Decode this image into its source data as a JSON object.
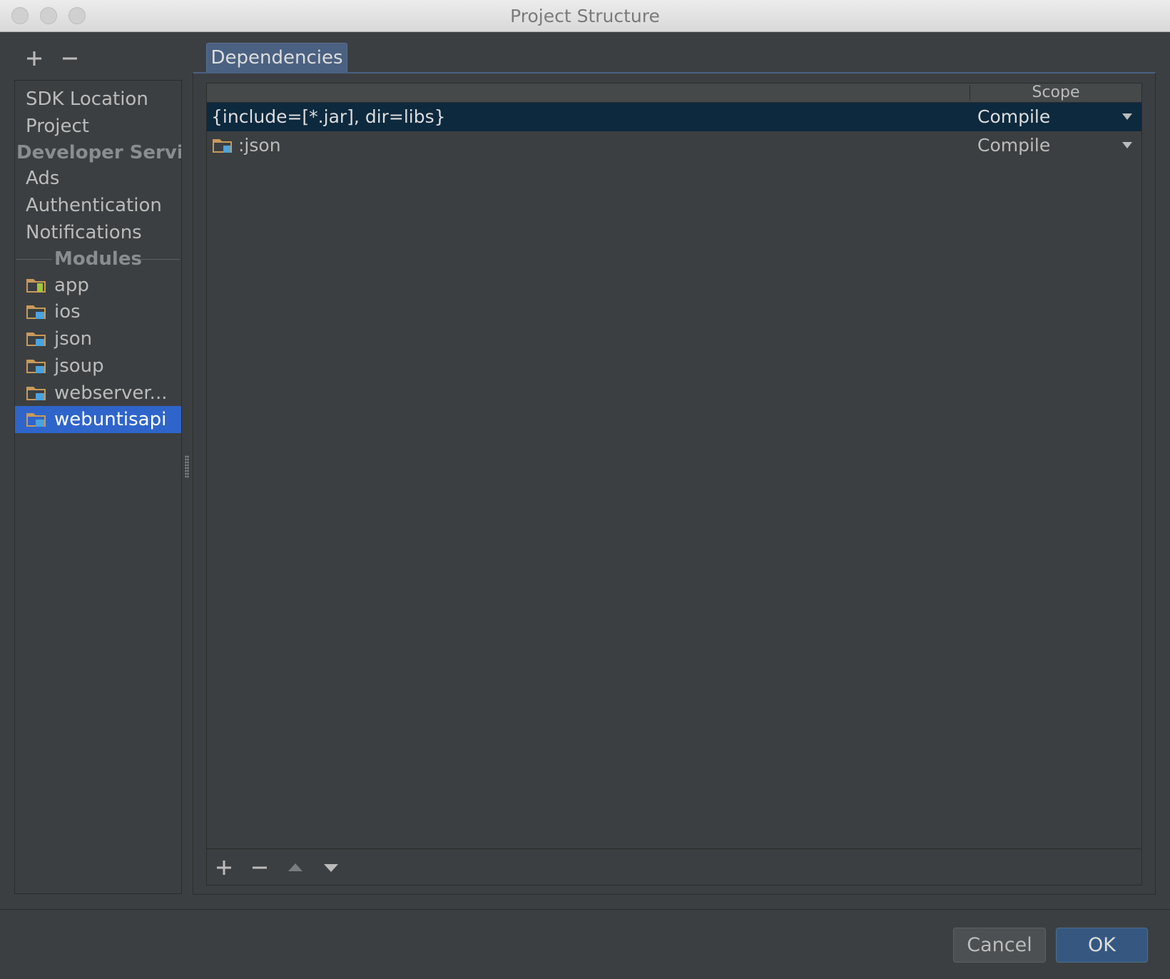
{
  "window": {
    "title": "Project Structure"
  },
  "sidebar": {
    "items": [
      {
        "label": "SDK Location"
      },
      {
        "label": "Project"
      }
    ],
    "developer_services": {
      "header": "Developer Servi...",
      "items": [
        {
          "label": "Ads"
        },
        {
          "label": "Authentication"
        },
        {
          "label": "Notifications"
        }
      ]
    },
    "modules_header": "Modules",
    "modules": [
      {
        "label": "app",
        "icon": "android-module-folder-icon"
      },
      {
        "label": "ios",
        "icon": "java-module-folder-icon"
      },
      {
        "label": "json",
        "icon": "java-module-folder-icon"
      },
      {
        "label": "jsoup",
        "icon": "java-module-folder-icon"
      },
      {
        "label": "webserver...",
        "icon": "java-module-folder-icon"
      },
      {
        "label": "webuntisapi",
        "icon": "java-module-folder-icon",
        "selected": true
      }
    ]
  },
  "tabs": [
    {
      "label": "Dependencies",
      "active": true
    }
  ],
  "dependencies": {
    "columns": {
      "name": "",
      "scope": "Scope"
    },
    "rows": [
      {
        "name": "{include=[*.jar], dir=libs}",
        "scope": "Compile",
        "selected": true
      },
      {
        "name": ":json",
        "scope": "Compile",
        "icon": "module-folder-icon"
      }
    ]
  },
  "buttons": {
    "cancel": "Cancel",
    "ok": "OK"
  },
  "colors": {
    "background": "#3c3f41",
    "selection": "#2f65ca",
    "table_selection": "#0d293e",
    "tab": "#4b6182",
    "ok_button": "#365880",
    "folder": "#c79a5a",
    "module_badge": "#4aa3df"
  }
}
